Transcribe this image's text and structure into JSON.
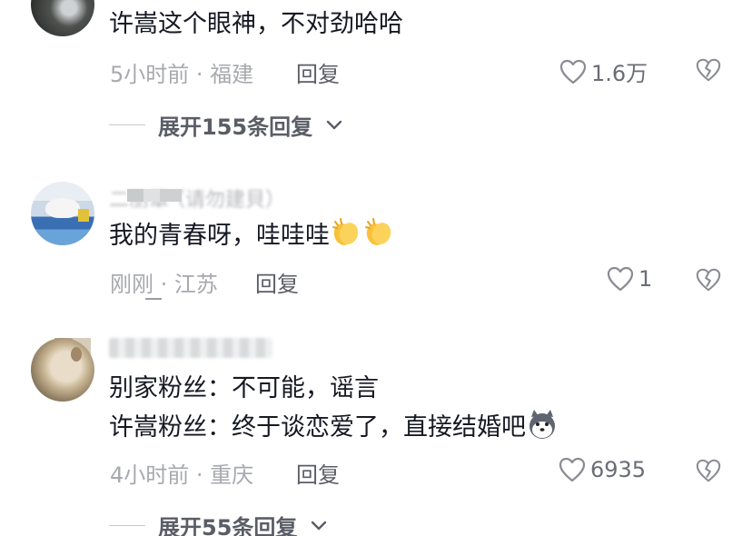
{
  "comments": [
    {
      "text_lines": [
        "许嵩这个眼神，不对劲哈哈"
      ],
      "meta": "5小时前 · 福建",
      "reply_label": "回复",
      "like_count": "1.6万",
      "expand_label": "展开155条回复"
    },
    {
      "username_blurred": "二丽罩·（请勿建貝）",
      "text_lines": [
        "我的青春呀，哇哇哇"
      ],
      "meta": "刚刚 · 江苏",
      "reply_label": "回复",
      "like_count": "1"
    },
    {
      "text_lines": [
        "别家粉丝：不可能，谣言",
        "许嵩粉丝：终于谈恋爱了，直接结婚吧"
      ],
      "meta": "4小时前 · 重庆",
      "reply_label": "回复",
      "like_count": "6935",
      "expand_label": "展开55条回复"
    }
  ],
  "icons": {
    "like": "heart-outline-icon",
    "dislike": "broken-heart-icon",
    "expand": "chevron-down-icon",
    "emoji_clap": "clapping-hands-emoji",
    "emoji_husky": "husky-dog-emoji"
  },
  "colors": {
    "text": "#161823",
    "meta": "#a7a9ae",
    "action": "#5b5d66"
  }
}
